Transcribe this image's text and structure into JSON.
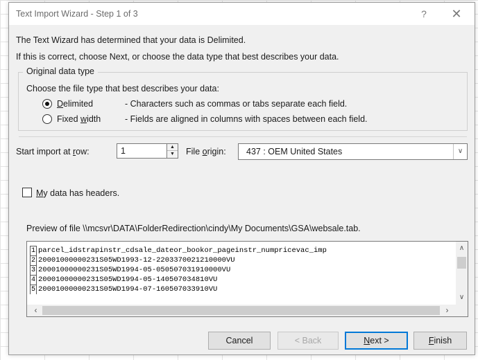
{
  "window": {
    "title": "Text Import Wizard - Step 1 of 3",
    "help_label": "?",
    "close_label": "✕"
  },
  "intro": {
    "line1": "The Text Wizard has determined that your data is Delimited.",
    "line2": "If this is correct, choose Next, or choose the data type that best describes your data."
  },
  "original_data_type": {
    "legend": "Original data type",
    "prompt": "Choose the file type that best describes your data:",
    "options": [
      {
        "label_u": "D",
        "label_rest": "elimited",
        "description": "- Characters such as commas or tabs separate each field.",
        "selected": true
      },
      {
        "label_pre": "Fixed ",
        "label_u": "w",
        "label_rest": "idth",
        "description": "- Fields are aligned in columns with spaces between each field.",
        "selected": false
      }
    ]
  },
  "start_row": {
    "label_pre": "Start import at ",
    "label_u": "r",
    "label_rest": "ow:",
    "value": "1"
  },
  "file_origin": {
    "label_pre": "File ",
    "label_u": "o",
    "label_rest": "rigin:",
    "value": "437 : OEM United States"
  },
  "headers_checkbox": {
    "label_u": "M",
    "label_rest": "y data has headers.",
    "checked": false
  },
  "preview": {
    "label": "Preview of file \\\\mcsvr\\DATA\\FolderRedirection\\cindy\\My Documents\\GSA\\websale.tab.",
    "rows": [
      {
        "num": "1",
        "text": "parcel_idstrapinstr_cdsale_dateor_bookor_pageinstr_numpricevac_imp"
      },
      {
        "num": "2",
        "text": "20001000000231S05WD1993-12-2203370021210000VU"
      },
      {
        "num": "3",
        "text": "20001000000231S05WD1994-05-050507031910000VU"
      },
      {
        "num": "4",
        "text": "20001000000231S05WD1994-05-140507034810VU"
      },
      {
        "num": "5",
        "text": "20001000000231S05WD1994-07-160507033910VU"
      }
    ]
  },
  "buttons": {
    "cancel": "Cancel",
    "back": "< Back",
    "next_u": "N",
    "next_rest": "ext >",
    "finish_u": "F",
    "finish_rest": "inish"
  },
  "icons": {
    "spin_up": "triangle-up-icon",
    "spin_down": "triangle-down-icon",
    "dropdown": "chevron-down-icon",
    "scroll_up": "chevron-up-icon",
    "scroll_down": "chevron-down-icon",
    "scroll_left": "chevron-left-icon",
    "scroll_right": "chevron-right-icon"
  }
}
